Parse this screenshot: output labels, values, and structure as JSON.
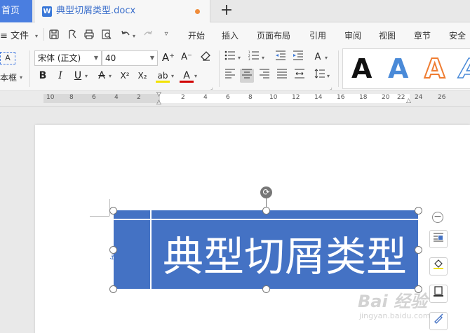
{
  "tabs": {
    "home_label": "首页",
    "doc_icon": "W",
    "doc_title": "典型切屑类型.docx",
    "new_tab_icon": "+"
  },
  "menubar": {
    "file_label": "≡ 文件",
    "tabs": [
      "开始",
      "插入",
      "页面布局",
      "引用",
      "审阅",
      "视图",
      "章节",
      "安全"
    ]
  },
  "ribbon": {
    "textbox_label": "本框",
    "font_name": "宋体 (正文)",
    "font_size": "40",
    "bold": "B",
    "italic": "I",
    "underline": "U",
    "strikethrough": "A",
    "superscript": "X²",
    "subscript": "X₂",
    "highlight": "ab",
    "font_color": "A",
    "grow_font": "A⁺",
    "shrink_font": "A⁻",
    "style_samples": [
      "A",
      "A",
      "A",
      "A"
    ]
  },
  "ruler": {
    "labels": [
      "10",
      "8",
      "6",
      "4",
      "2",
      "2",
      "4",
      "6",
      "8",
      "10",
      "12",
      "14",
      "16",
      "18",
      "20",
      "22",
      "24",
      "26"
    ]
  },
  "document": {
    "shape_text": "典型切屑类型",
    "shape_color": "#4472c4"
  },
  "colors": {
    "accent": "#4a7ee0",
    "tab_title": "#3a6ecb",
    "unsaved_dot": "#f08c3a"
  },
  "watermark": {
    "line1": "Bai 经验",
    "line2": "jingyan.baidu.com"
  }
}
